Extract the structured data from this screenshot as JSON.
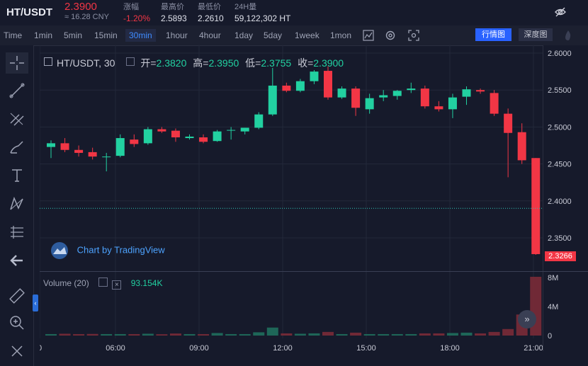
{
  "header": {
    "pair": "HT/USDT",
    "price": "2.3900",
    "cny": "≈ 16.28 CNY",
    "stats": [
      {
        "label": "涨幅",
        "value": "-1.20%",
        "neg": true
      },
      {
        "label": "最高价",
        "value": "2.5893"
      },
      {
        "label": "最低价",
        "value": "2.2610"
      },
      {
        "label": "24H量",
        "value": "59,122,302 HT"
      }
    ]
  },
  "toolbar": {
    "intervals": [
      "Time",
      "1min",
      "5min",
      "15min",
      "30min",
      "1hour",
      "4hour",
      "1day",
      "5day",
      "1week",
      "1mon"
    ],
    "active": "30min",
    "view_buttons": [
      "行情图",
      "深度图"
    ]
  },
  "legend": {
    "symbol": "HT/USDT, 30",
    "open_label": "开=",
    "open": "2.3820",
    "high_label": "高=",
    "high": "2.3950",
    "low_label": "低=",
    "low": "2.3755",
    "close_label": "收=",
    "close": "2.3900"
  },
  "volume_legend": {
    "label": "Volume (20)",
    "value": "93.154K"
  },
  "watermark": "Chart by TradingView",
  "last_price_label": "2.3266",
  "price_axis_ticks": [
    "2.6000",
    "2.5500",
    "2.5000",
    "2.4500",
    "2.4000",
    "2.3500"
  ],
  "volume_axis_ticks": [
    "8M",
    "4M",
    "0"
  ],
  "time_axis_ticks": [
    "0",
    "06:00",
    "09:00",
    "12:00",
    "15:00",
    "18:00",
    "21:00"
  ],
  "colors": {
    "up": "#22d1a1",
    "down": "#f23645",
    "bg": "#161a2b",
    "grid": "#23283a"
  },
  "icons": [
    "crosshair-icon",
    "trendline-icon",
    "fib-icon",
    "brush-icon",
    "text-icon",
    "pattern-icon",
    "measure-icon",
    "back-arrow-icon",
    "ruler-icon",
    "zoom-icon",
    "eye-off-icon",
    "indicator-icon",
    "settings-icon",
    "screenshot-icon"
  ],
  "chart_data": {
    "type": "candlestick",
    "price_range": [
      2.305,
      2.605
    ],
    "horizontal_line": 2.39,
    "volume_range_M": [
      0,
      8
    ],
    "candles": [
      {
        "o": 2.473,
        "h": 2.482,
        "l": 2.458,
        "c": 2.478,
        "v": 0.2
      },
      {
        "o": 2.478,
        "h": 2.485,
        "l": 2.466,
        "c": 2.469,
        "v": 0.25
      },
      {
        "o": 2.469,
        "h": 2.475,
        "l": 2.46,
        "c": 2.465,
        "v": 0.2
      },
      {
        "o": 2.466,
        "h": 2.472,
        "l": 2.456,
        "c": 2.46,
        "v": 0.22
      },
      {
        "o": 2.46,
        "h": 2.465,
        "l": 2.44,
        "c": 2.46,
        "v": 0.2
      },
      {
        "o": 2.461,
        "h": 2.49,
        "l": 2.459,
        "c": 2.485,
        "v": 0.2
      },
      {
        "o": 2.483,
        "h": 2.49,
        "l": 2.473,
        "c": 2.477,
        "v": 0.2
      },
      {
        "o": 2.478,
        "h": 2.5,
        "l": 2.476,
        "c": 2.497,
        "v": 0.25
      },
      {
        "o": 2.497,
        "h": 2.5,
        "l": 2.492,
        "c": 2.494,
        "v": 0.18
      },
      {
        "o": 2.495,
        "h": 2.498,
        "l": 2.48,
        "c": 2.486,
        "v": 0.28
      },
      {
        "o": 2.485,
        "h": 2.49,
        "l": 2.483,
        "c": 2.487,
        "v": 0.2
      },
      {
        "o": 2.486,
        "h": 2.49,
        "l": 2.478,
        "c": 2.48,
        "v": 0.2
      },
      {
        "o": 2.481,
        "h": 2.496,
        "l": 2.48,
        "c": 2.494,
        "v": 0.35
      },
      {
        "o": 2.496,
        "h": 2.5,
        "l": 2.483,
        "c": 2.496,
        "v": 0.2
      },
      {
        "o": 2.494,
        "h": 2.499,
        "l": 2.49,
        "c": 2.499,
        "v": 0.2
      },
      {
        "o": 2.499,
        "h": 2.52,
        "l": 2.497,
        "c": 2.517,
        "v": 0.45
      },
      {
        "o": 2.517,
        "h": 2.58,
        "l": 2.515,
        "c": 2.556,
        "v": 1.1
      },
      {
        "o": 2.556,
        "h": 2.56,
        "l": 2.547,
        "c": 2.549,
        "v": 0.3
      },
      {
        "o": 2.549,
        "h": 2.565,
        "l": 2.547,
        "c": 2.562,
        "v": 0.25
      },
      {
        "o": 2.562,
        "h": 2.577,
        "l": 2.558,
        "c": 2.575,
        "v": 0.3
      },
      {
        "o": 2.576,
        "h": 2.582,
        "l": 2.537,
        "c": 2.54,
        "v": 0.5
      },
      {
        "o": 2.54,
        "h": 2.555,
        "l": 2.538,
        "c": 2.552,
        "v": 0.2
      },
      {
        "o": 2.552,
        "h": 2.555,
        "l": 2.515,
        "c": 2.526,
        "v": 0.4
      },
      {
        "o": 2.524,
        "h": 2.545,
        "l": 2.518,
        "c": 2.539,
        "v": 0.2
      },
      {
        "o": 2.54,
        "h": 2.55,
        "l": 2.535,
        "c": 2.543,
        "v": 0.2
      },
      {
        "o": 2.542,
        "h": 2.55,
        "l": 2.537,
        "c": 2.549,
        "v": 0.2
      },
      {
        "o": 2.55,
        "h": 2.56,
        "l": 2.546,
        "c": 2.552,
        "v": 0.2
      },
      {
        "o": 2.552,
        "h": 2.556,
        "l": 2.525,
        "c": 2.528,
        "v": 0.3
      },
      {
        "o": 2.528,
        "h": 2.535,
        "l": 2.521,
        "c": 2.524,
        "v": 0.3
      },
      {
        "o": 2.524,
        "h": 2.545,
        "l": 2.512,
        "c": 2.54,
        "v": 0.35
      },
      {
        "o": 2.541,
        "h": 2.555,
        "l": 2.53,
        "c": 2.551,
        "v": 0.4
      },
      {
        "o": 2.55,
        "h": 2.552,
        "l": 2.545,
        "c": 2.548,
        "v": 0.3
      },
      {
        "o": 2.546,
        "h": 2.55,
        "l": 2.515,
        "c": 2.518,
        "v": 0.5
      },
      {
        "o": 2.518,
        "h": 2.525,
        "l": 2.432,
        "c": 2.492,
        "v": 0.9
      },
      {
        "o": 2.493,
        "h": 2.505,
        "l": 2.45,
        "c": 2.455,
        "v": 2.9
      },
      {
        "o": 2.458,
        "h": 2.458,
        "l": 2.327,
        "c": 2.328,
        "v": 8.1
      }
    ]
  }
}
